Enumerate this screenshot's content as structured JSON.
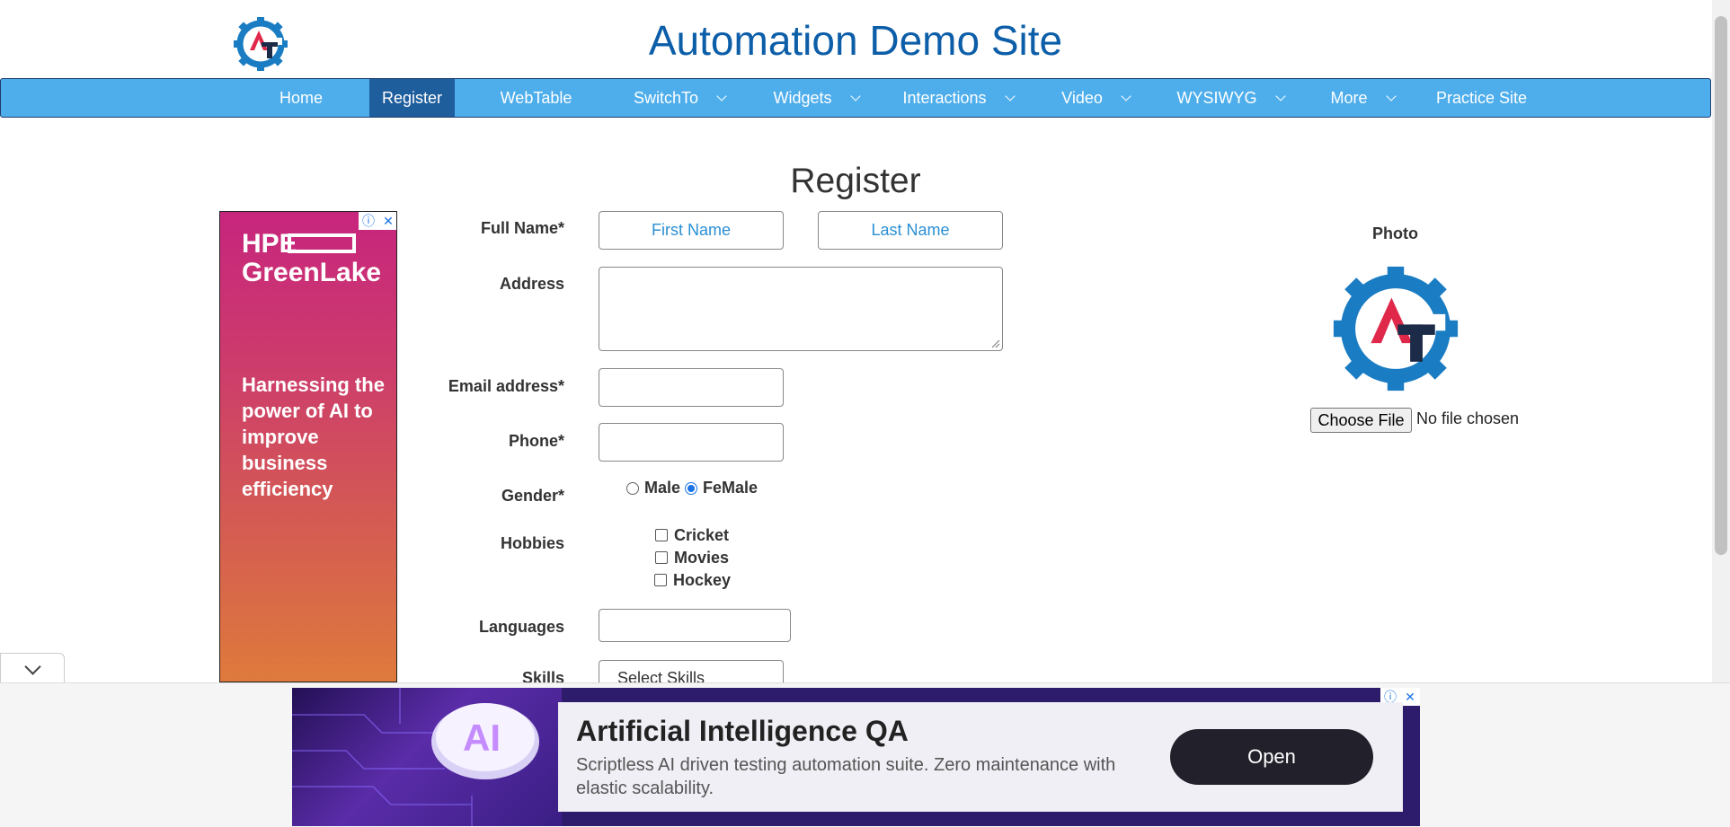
{
  "header": {
    "site_title": "Automation Demo Site"
  },
  "nav": {
    "items": [
      {
        "label": "Home"
      },
      {
        "label": "Register",
        "active": true
      },
      {
        "label": "WebTable"
      },
      {
        "label": "SwitchTo"
      },
      {
        "label": "Widgets"
      },
      {
        "label": "Interactions"
      },
      {
        "label": "Video"
      },
      {
        "label": "WYSIWYG"
      },
      {
        "label": "More"
      },
      {
        "label": "Practice Site"
      }
    ]
  },
  "page": {
    "heading": "Register"
  },
  "ad_left": {
    "brand_line1": "HPE",
    "brand_line2": "GreenLake",
    "copy": "Harnessing the power of AI to improve business efficiency",
    "info_icon": "info-icon",
    "close_icon": "close-icon"
  },
  "form": {
    "full_name_label": "Full Name*",
    "first_name_placeholder": "First Name",
    "last_name_placeholder": "Last Name",
    "address_label": "Address",
    "email_label": "Email address*",
    "phone_label": "Phone*",
    "gender_label": "Gender*",
    "gender_options": [
      "Male",
      "FeMale"
    ],
    "gender_selected": "FeMale",
    "hobbies_label": "Hobbies",
    "hobbies": [
      "Cricket",
      "Movies",
      "Hockey"
    ],
    "languages_label": "Languages",
    "skills_label": "Skills",
    "skills_placeholder": "Select Skills"
  },
  "photo": {
    "label": "Photo",
    "file_button": "Choose File",
    "file_status": "No file chosen"
  },
  "ad_bottom": {
    "title": "Artificial Intelligence QA",
    "description": "Scriptless AI driven testing automation suite. Zero maintenance with elastic scalability.",
    "cta": "Open"
  },
  "colors": {
    "nav_bg": "#4eaeec",
    "nav_active": "#1f5e9c",
    "title": "#0c5ea8",
    "logo_blue": "#1a7cc2",
    "logo_red": "#e0294a",
    "logo_navy": "#1c2b48"
  }
}
